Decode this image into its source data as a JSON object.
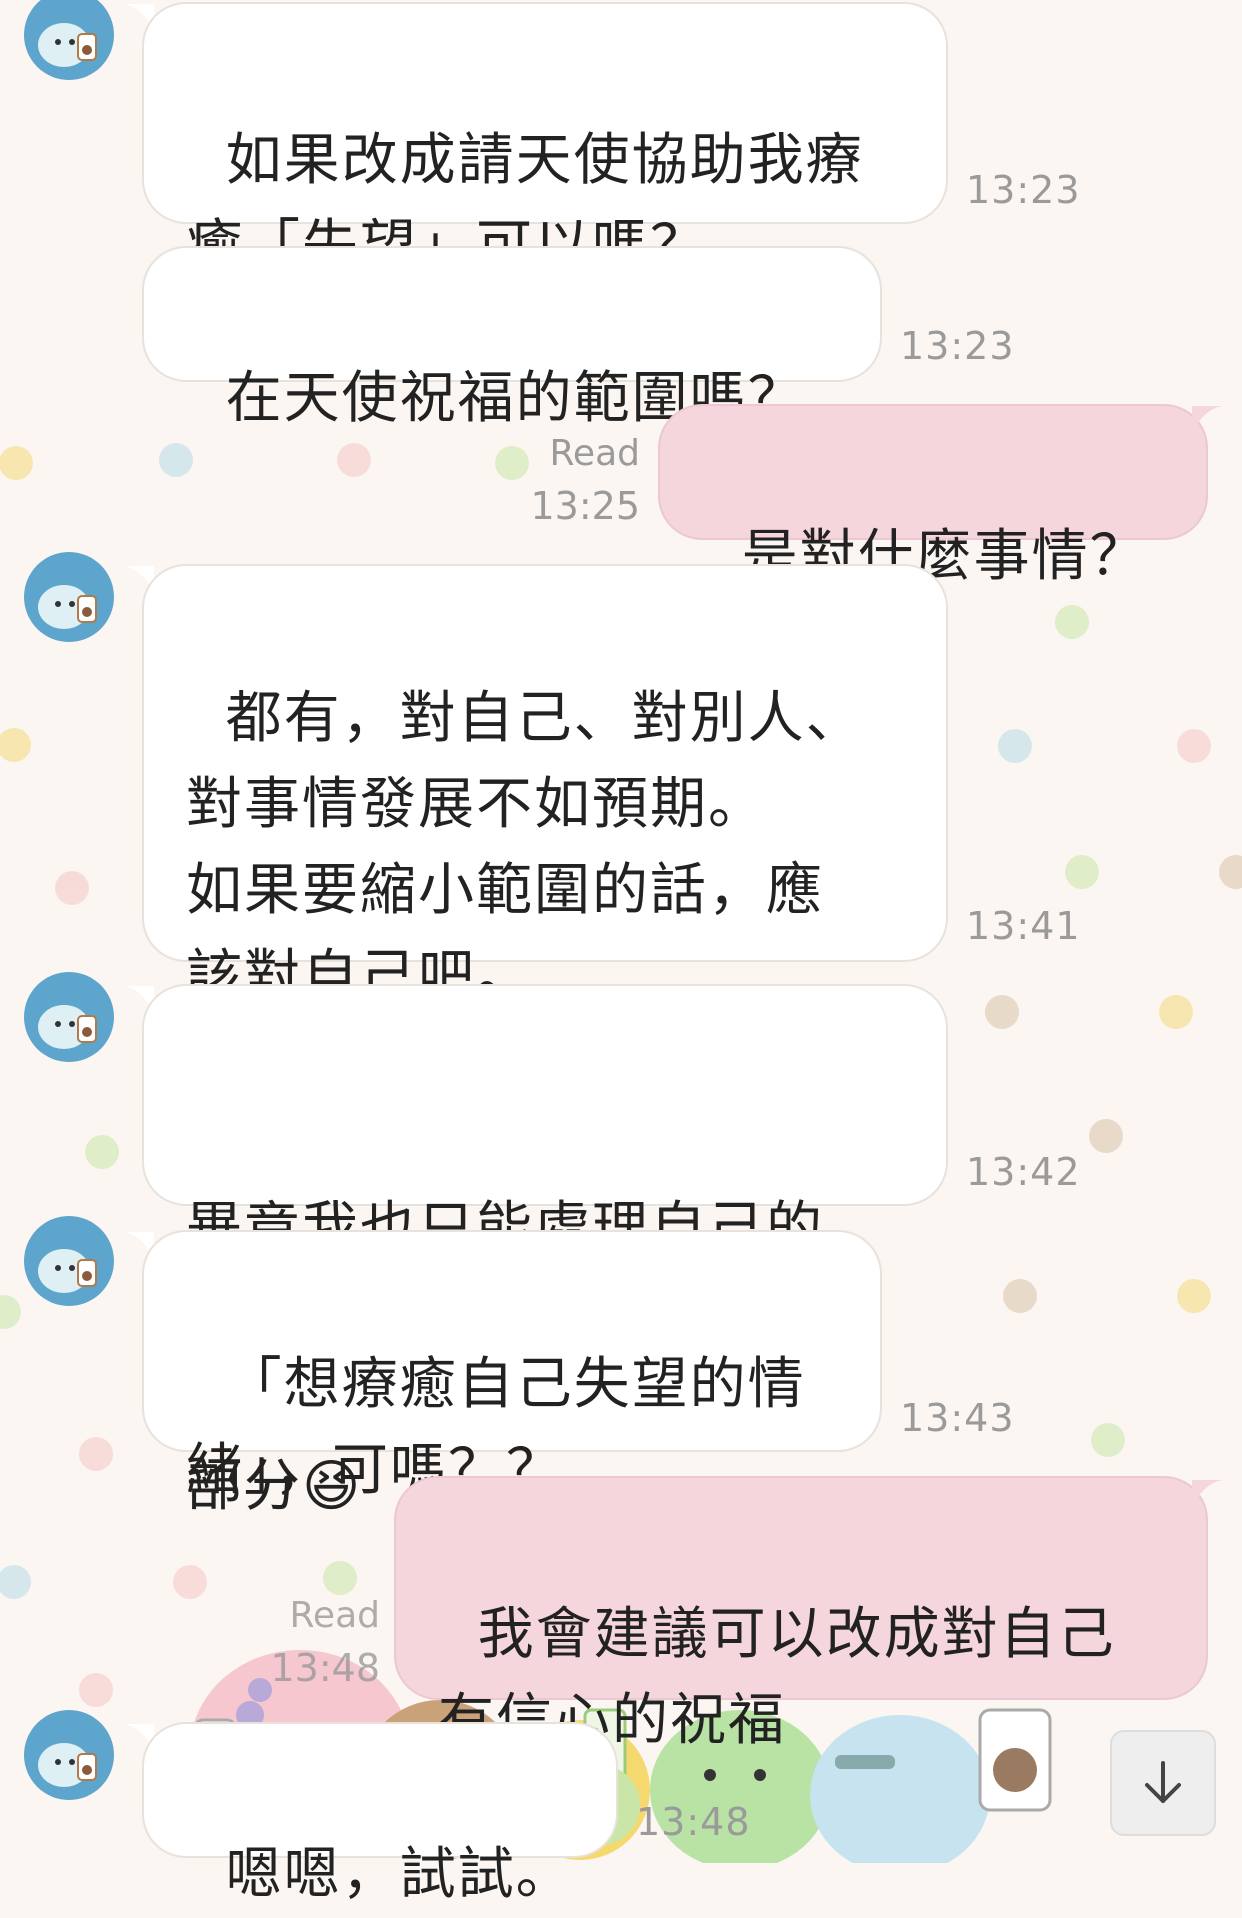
{
  "colors": {
    "background": "#fbf6f2",
    "incoming_bubble": "#ffffff",
    "outgoing_bubble": "#f4d6dc",
    "timestamp": "#9a9a9a",
    "avatar": "#5da5cd"
  },
  "icons": {
    "avatar": "dinosaur-avatar-icon",
    "scroll": "arrow-down-icon",
    "emoji": "grinning-squinting-face-icon"
  },
  "messages": [
    {
      "direction": "in",
      "text": "如果改成請天使協助我療\n癒「失望」可以嗎？",
      "time": "13:23"
    },
    {
      "direction": "in",
      "text": "在天使祝福的範圍嗎？",
      "time": "13:23"
    },
    {
      "direction": "out",
      "text": "是對什麼事情？",
      "read": "Read",
      "time": "13:25"
    },
    {
      "direction": "in",
      "text": "都有，對自己、對別人、\n對事情發展不如預期。\n如果要縮小範圍的話，應\n該對自己吧。",
      "time": "13:41"
    },
    {
      "direction": "in",
      "text_line1": "畢竟我也只能處理自己的",
      "text_line2": "部分",
      "emoji": "😆",
      "time": "13:42"
    },
    {
      "direction": "in",
      "text": "「想療癒自己失望的情\n緒」，可嗎？？",
      "time": "13:43"
    },
    {
      "direction": "out",
      "text": "我會建議可以改成對自己\n有信心的祝福",
      "read": "Read",
      "time": "13:48"
    },
    {
      "direction": "in",
      "text": "嗯嗯，試試。",
      "time": "13:48"
    }
  ]
}
